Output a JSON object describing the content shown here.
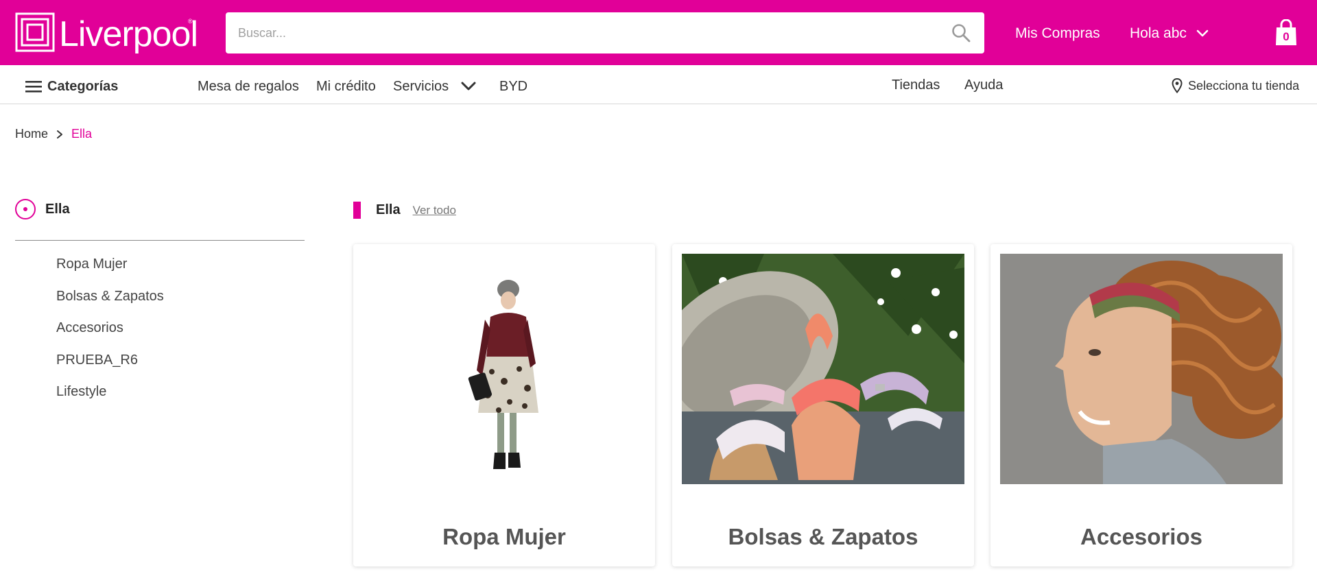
{
  "header": {
    "logo_text": "Liverpool",
    "search_placeholder": "Buscar...",
    "mis_compras": "Mis Compras",
    "greeting": "Hola abc",
    "cart_count": "0"
  },
  "nav": {
    "categorias": "Categorías",
    "mesa": "Mesa de regalos",
    "credito": "Mi crédito",
    "servicios": "Servicios",
    "byd": "BYD",
    "tiendas": "Tiendas",
    "ayuda": "Ayuda",
    "store": "Selecciona tu tienda"
  },
  "breadcrumb": {
    "home": "Home",
    "current": "Ella"
  },
  "sidebar": {
    "heading": "Ella",
    "items": [
      "Ropa Mujer",
      "Bolsas & Zapatos",
      "Accesorios",
      "PRUEBA_R6",
      "Lifestyle"
    ]
  },
  "main": {
    "section_title": "Ella",
    "see_all": "Ver todo",
    "cards": [
      {
        "title": "Ropa Mujer"
      },
      {
        "title": "Bolsas & Zapatos"
      },
      {
        "title": "Accesorios"
      }
    ]
  },
  "colors": {
    "brand": "#e10098"
  }
}
